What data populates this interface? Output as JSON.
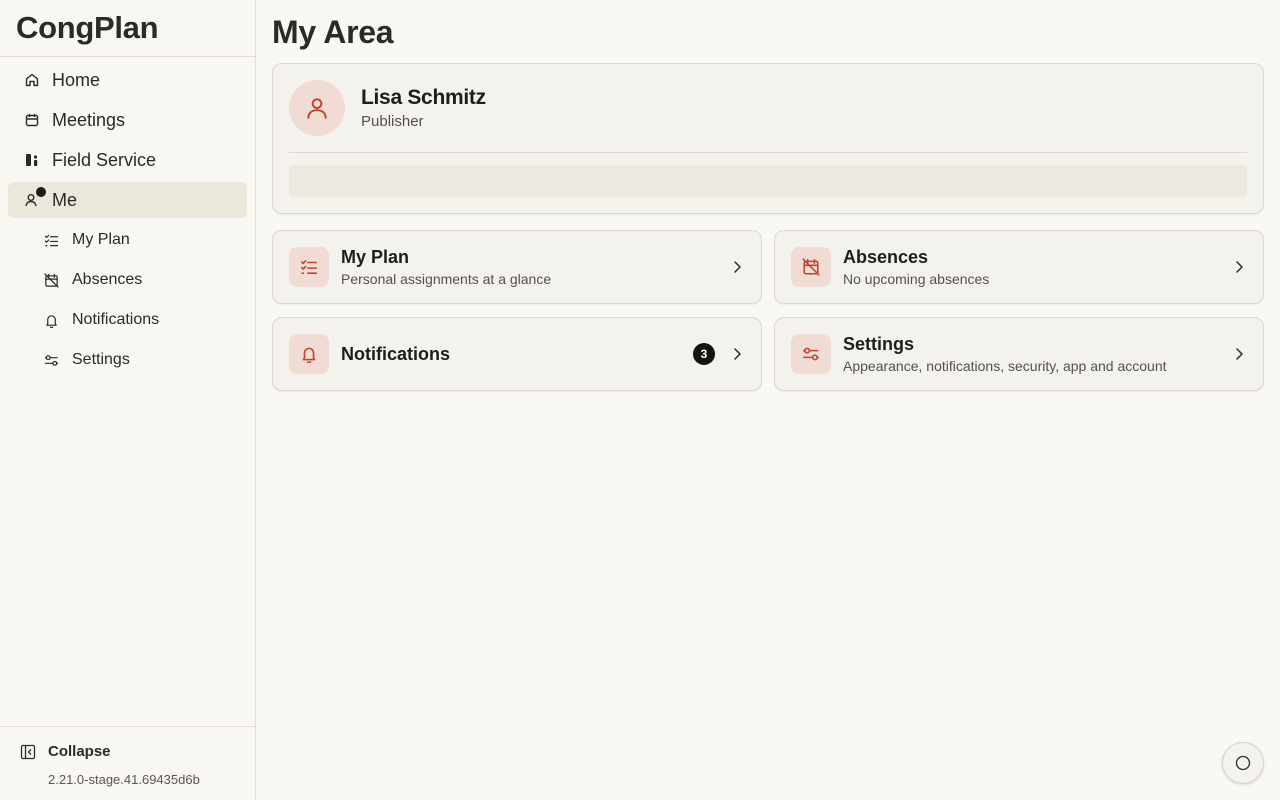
{
  "app": {
    "brand": "CongPlan"
  },
  "colors": {
    "accent": "#c0442b",
    "accent_bg": "#f0dcd4",
    "active_bg": "#ebe7db"
  },
  "sidebar": {
    "items": [
      {
        "label": "Home",
        "icon": "home-icon"
      },
      {
        "label": "Meetings",
        "icon": "calendar-icon"
      },
      {
        "label": "Field Service",
        "icon": "field-service-icon"
      },
      {
        "label": "Me",
        "icon": "user-icon",
        "active": true
      }
    ],
    "subitems": [
      {
        "label": "My Plan",
        "icon": "checklist-icon"
      },
      {
        "label": "Absences",
        "icon": "calendar-off-icon"
      },
      {
        "label": "Notifications",
        "icon": "bell-icon"
      },
      {
        "label": "Settings",
        "icon": "sliders-icon"
      }
    ],
    "collapse_label": "Collapse",
    "version": "2.21.0-stage.41.69435d6b"
  },
  "main": {
    "title": "My Area",
    "profile": {
      "name": "Lisa Schmitz",
      "role": "Publisher"
    },
    "tiles": [
      {
        "title": "My Plan",
        "subtitle": "Personal assignments at a glance",
        "icon": "checklist-icon"
      },
      {
        "title": "Absences",
        "subtitle": "No upcoming absences",
        "icon": "calendar-off-icon"
      },
      {
        "title": "Notifications",
        "badge": "3",
        "icon": "bell-icon"
      },
      {
        "title": "Settings",
        "subtitle": "Appearance, notifications, security, app and account",
        "icon": "sliders-icon"
      }
    ]
  }
}
